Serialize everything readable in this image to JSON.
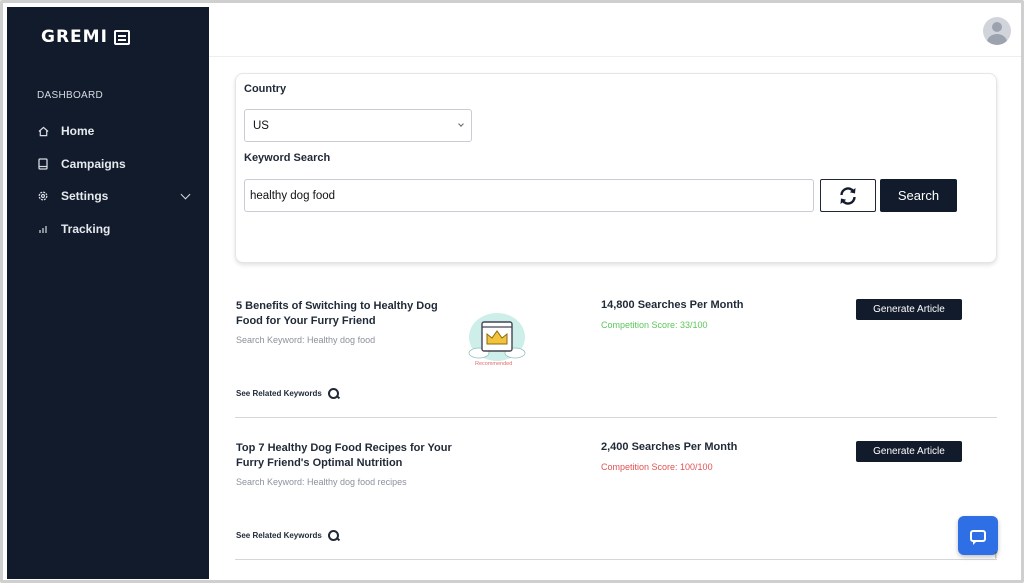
{
  "brand": {
    "name": "GREMI",
    "icon": "newspaper-icon"
  },
  "sidebar": {
    "section_label": "DASHBOARD",
    "items": [
      {
        "label": "Home",
        "icon": "home-icon"
      },
      {
        "label": "Campaigns",
        "icon": "book-icon"
      },
      {
        "label": "Settings",
        "icon": "gear-icon",
        "expandable": true
      },
      {
        "label": "Tracking",
        "icon": "bar-chart-icon"
      }
    ]
  },
  "search_form": {
    "country_label": "Country",
    "country_value": "US",
    "keyword_label": "Keyword Search",
    "keyword_value": "healthy dog food",
    "search_button": "Search"
  },
  "results": [
    {
      "title": "5 Benefits of Switching to Healthy Dog Food for Your Furry Friend",
      "search_keyword": "Search Keyword: Healthy dog food",
      "searches": "14,800 Searches Per Month",
      "competition": "Competition Score: 33/100",
      "competition_color": "#5cc75c",
      "badge": "Recommended",
      "generate_label": "Generate Article",
      "related_label": "See Related Keywords"
    },
    {
      "title": "Top 7 Healthy Dog Food Recipes for Your Furry Friend's Optimal Nutrition",
      "search_keyword": "Search Keyword: Healthy dog food recipes",
      "searches": "2,400 Searches Per Month",
      "competition": "Competition Score: 100/100",
      "competition_color": "#e05252",
      "generate_label": "Generate Article",
      "related_label": "See Related Keywords"
    }
  ],
  "colors": {
    "sidebar_bg": "#111b2b",
    "accent": "#2f6fe6"
  }
}
